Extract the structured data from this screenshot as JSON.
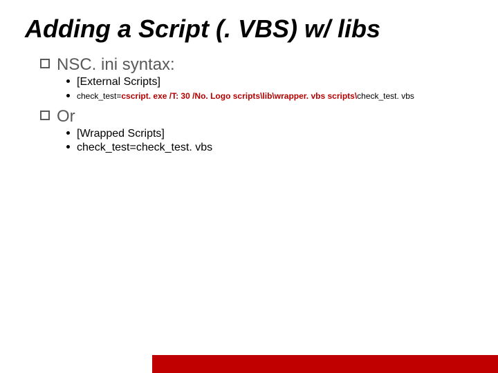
{
  "title": "Adding a Script (. VBS) w/ libs",
  "items": [
    {
      "level": 1,
      "text": "NSC. ini syntax:"
    },
    {
      "level": 2,
      "text": "[External Scripts]"
    },
    {
      "level": 2,
      "small": true,
      "spans": [
        {
          "t": "check_test="
        },
        {
          "t": "cscript. exe /T: 30 /No. Logo scripts\\lib\\wrapper. vbs scripts\\",
          "hl": true
        },
        {
          "t": "check_test. vbs"
        }
      ]
    },
    {
      "level": 1,
      "text": "Or"
    },
    {
      "level": 2,
      "text": "[Wrapped Scripts]"
    },
    {
      "level": 2,
      "text": "check_test=check_test. vbs"
    }
  ]
}
